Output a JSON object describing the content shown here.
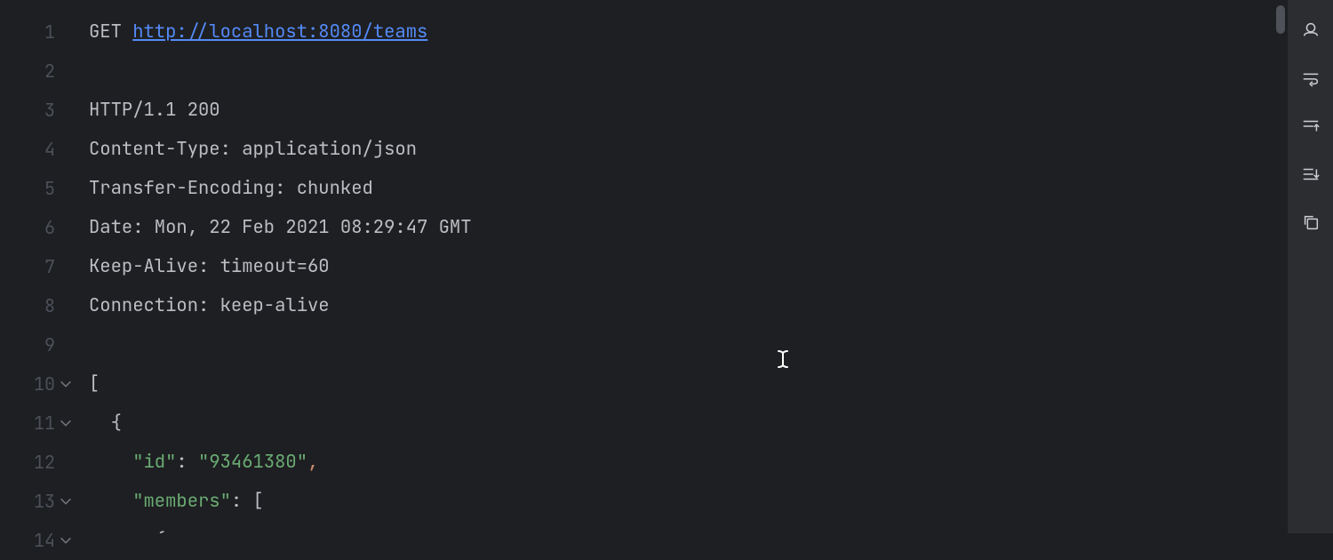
{
  "lines": {
    "l1_method": "GET ",
    "l1_url": "http://localhost:8080/teams",
    "l2": "",
    "l3": "HTTP/1.1 200",
    "l4": "Content-Type: application/json",
    "l5": "Transfer-Encoding: chunked",
    "l6": "Date: Mon, 22 Feb 2021 08:29:47 GMT",
    "l7": "Keep-Alive: timeout=60",
    "l8": "Connection: keep-alive",
    "l9": "",
    "l10": "[",
    "l11_indent": "  ",
    "l11_brace": "{",
    "l12_indent": "    ",
    "l12_key": "\"id\"",
    "l12_colon": ": ",
    "l12_val": "\"93461380\"",
    "l12_comma": ",",
    "l13_indent": "    ",
    "l13_key": "\"members\"",
    "l13_colon": ": ",
    "l13_val": "[",
    "l14_indent": "      ",
    "l14_brace": "{"
  },
  "ln": {
    "1": "1",
    "2": "2",
    "3": "3",
    "4": "4",
    "5": "5",
    "6": "6",
    "7": "7",
    "8": "8",
    "9": "9",
    "10": "10",
    "11": "11",
    "12": "12",
    "13": "13",
    "14": "14"
  }
}
